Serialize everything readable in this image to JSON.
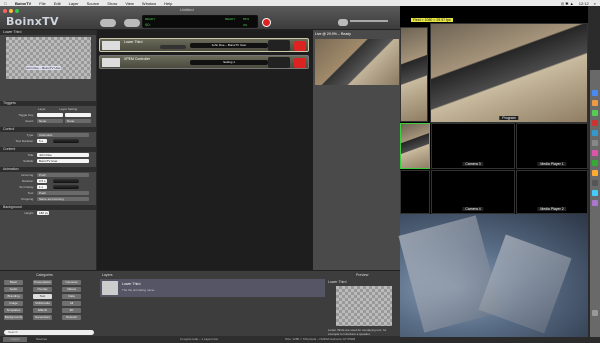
{
  "menubar": {
    "app_name": "BoinxTV",
    "items": [
      "File",
      "Edit",
      "Layer",
      "Source",
      "Show",
      "View",
      "Window",
      "Help"
    ],
    "clock": "12:12"
  },
  "window": {
    "title": "Untitled",
    "logo": "BoinxTV",
    "meter_left": "READY",
    "meter_center": "00:",
    "meter_ready": "READY",
    "meter_right_pct": "56%",
    "meter_right_sub": "OK"
  },
  "inspector": {
    "header": "Lower Third",
    "thumb_text": "John Doe – BoinxTV User",
    "sections": {
      "triggers": "Triggers",
      "control": "Control",
      "content": "Content",
      "animation": "Animation",
      "background": "Background"
    },
    "triggers": {
      "toggle_key_label": "Toggle Key:",
      "event_label": "Event:",
      "layer_col": "Layer",
      "layer_setting_col": "Layer Setting",
      "event_left": "None",
      "event_right": "None"
    },
    "control": {
      "type_label": "Type:",
      "type_value": "Automatic",
      "duration_label": "Text Duration:",
      "duration_value": "5 s"
    },
    "content": {
      "title_label": "Title:",
      "title_value": "John Doe",
      "subtitle_label": "Subtitle:",
      "subtitle_value": "BoinxTV User"
    },
    "animation": {
      "incoming_label": "Incoming:",
      "incoming_value": "Push",
      "duration_label": "Duration:",
      "duration_value": "0.5 s",
      "delay_label": "Text Delay:",
      "delay_value": "1 s",
      "text_label": "Text:",
      "text_value": "Push",
      "outgoing_label": "Outgoing:",
      "outgoing_value": "Same as incoming"
    },
    "background": {
      "height_label": "Height:",
      "height_value": "180 px"
    }
  },
  "layers": [
    {
      "name": "Lower Third",
      "box": "John Doe – BoinxTV User"
    },
    {
      "name": "XPEM Controller",
      "box": "Setting 1"
    }
  ],
  "live": {
    "header": "Live @ 29.9% – Ready"
  },
  "bottom": {
    "categories_header": "Categories",
    "layers_header": "Layers",
    "preview_header": "Preview",
    "categories": [
      "Basic",
      "Presentation",
      "Cameras",
      "Audio",
      "Overlay",
      "Videos",
      "Branding",
      "Text",
      "Data",
      "Image",
      "Multimedia",
      "All",
      "Templates",
      "Effects",
      "3D",
      "Backgrounds",
      "Generators",
      "Network"
    ],
    "selected_category": "Text",
    "lib_item_title": "Lower Third",
    "lib_item_sub": "The the animating name",
    "preview_title": "Lower Third",
    "preview_desc": "Lower thirds are used for overlaying text, for example to introduce a speaker.",
    "search_placeholder": "Search",
    "tab_layers": "Layers",
    "tab_sources": "Sources",
    "status_left": "2 Layers total – 1 Layers live",
    "status_right": "Size: 1280 × 720 pixels – NVIDIA GeForce GT 650M"
  },
  "multiview": {
    "tag": "Field > 1080 > 29.97 fps",
    "captions": {
      "program": "Program",
      "camera3": "Camera 3",
      "media1": "Media Player 1",
      "camera4": "Camera 4",
      "media2": "Media Player 2"
    }
  },
  "colors": {
    "record": "#dd2222",
    "stop": "#dd2222",
    "layer_active": "#c9c9aa",
    "selected_green": "#3ecf3e"
  }
}
